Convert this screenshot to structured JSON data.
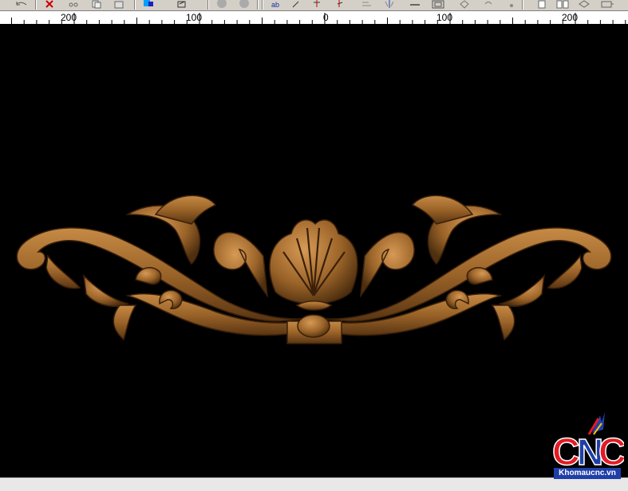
{
  "ruler": {
    "labels": [
      "200",
      "100",
      "0",
      "100",
      "200"
    ]
  },
  "toolbar": {
    "icons": [
      "undo-icon",
      "cut-icon",
      "scissors-icon",
      "copy-icon",
      "paste-icon",
      "color-icon",
      "edit-icon",
      "circle-icon",
      "circle-icon-2",
      "node-icon",
      "pen-icon",
      "vector-icon",
      "pen-icon-2",
      "align-icon",
      "mirror-icon",
      "minus-icon",
      "frame-icon",
      "move-icon",
      "rotate-icon",
      "snap-icon",
      "page-icon",
      "layers-icon",
      "view-icon",
      "zoom-icon"
    ]
  },
  "logo": {
    "letters": "CNC",
    "website": "Khomaucnc.vn",
    "colors": {
      "c1": "#e31b23",
      "n": "#1f3fa8",
      "c2": "#e31b23",
      "banner": "#1f3fa8"
    }
  },
  "ornament": {
    "subject": "carved wooden acanthus scroll ornament with central shell",
    "colors": {
      "wood_light": "#c68a45",
      "wood_mid": "#9a6328",
      "wood_dark": "#4e2f0f"
    }
  }
}
